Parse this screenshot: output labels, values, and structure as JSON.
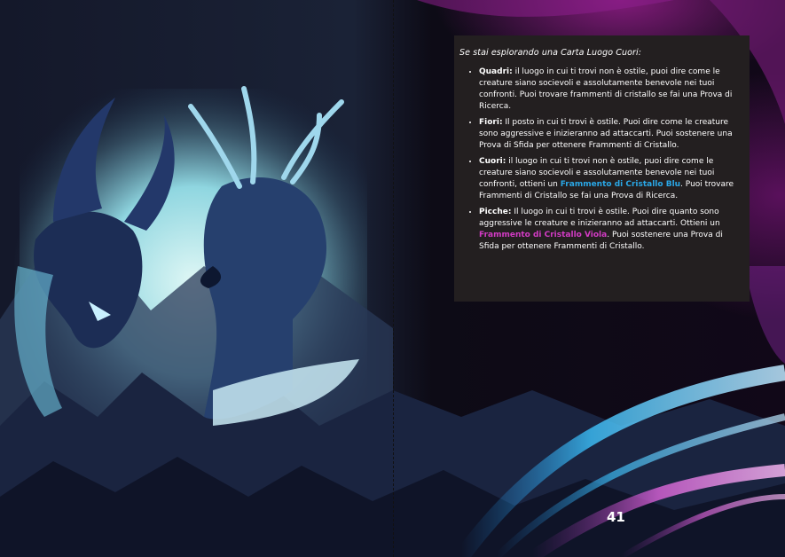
{
  "page": {
    "intro": "Se stai esplorando una Carta Luogo Cuori:",
    "page_number": "41"
  },
  "items": [
    {
      "lead": "Quadri:",
      "text_a": " il luogo in cui ti trovi non è ostile, puoi dire come le creature siano socievoli e assolutamente benevole nei tuoi confronti. Puoi trovare frammenti di cristallo se fai una Prova di Ricerca.",
      "highlight": "",
      "text_b": ""
    },
    {
      "lead": "Fiori:",
      "text_a": " Il posto in cui ti trovi è ostile. Puoi dire come le creature sono aggressive e inizieranno ad attaccarti. Puoi sostenere una Prova di Sfida per ottenere Frammenti di Cristallo.",
      "highlight": "",
      "text_b": ""
    },
    {
      "lead": "Cuori:",
      "text_a": " il luogo in cui ti trovi non è ostile, puoi dire come le creature siano socievoli e assolutamente benevole nei tuoi confronti, ottieni un ",
      "highlight": "Frammento di Cristallo Blu",
      "text_b": ". Puoi trovare Frammenti di Cristallo se fai una Prova di Ricerca."
    },
    {
      "lead": "Picche:",
      "text_a": " Il luogo in cui ti trovi è ostile. Puoi dire quanto sono aggressive le creature e inizieranno ad attaccarti. Ottieni un ",
      "highlight": "Frammento di Cristallo Viola",
      "text_b": ". Puoi sostenere una Prova di Sfida per ottenere Frammenti di Cristallo."
    }
  ],
  "colors": {
    "box_background": "#231f20",
    "blue_highlight": "#2aa7e6",
    "violet_highlight": "#d23bc4"
  },
  "icons": [
    "horned-demon-illustration",
    "antlered-wolf-illustration",
    "mountain-landscape",
    "light-ribbons"
  ]
}
